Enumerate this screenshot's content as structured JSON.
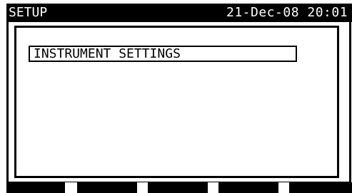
{
  "header": {
    "title": "SETUP",
    "datetime": "21-Dec-08 20:01"
  },
  "menu": {
    "items": [
      {
        "label": "INSTRUMENT SETTINGS",
        "selected": true
      }
    ]
  },
  "function_keys": [
    {
      "label": ""
    },
    {
      "label": ""
    },
    {
      "label": ""
    },
    {
      "label": ""
    },
    {
      "label": ""
    }
  ],
  "colors": {
    "foreground": "#000000",
    "background": "#ffffff"
  }
}
